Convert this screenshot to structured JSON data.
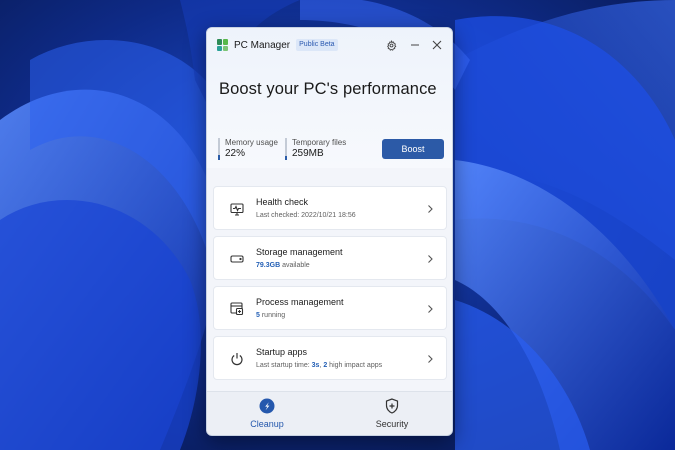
{
  "window": {
    "app_name": "PC Manager",
    "badge": "Public Beta",
    "hero_title": "Boost your PC's performance"
  },
  "metrics": {
    "memory": {
      "label": "Memory usage",
      "value": "22%",
      "level": 0.22
    },
    "temp": {
      "label": "Temporary files",
      "value": "259MB",
      "level": 0.2
    }
  },
  "boost_label": "Boost",
  "cards": [
    {
      "title": "Health check",
      "sub": "Last checked: 2022/10/21 18:56",
      "icon": "monitor-pulse-icon"
    },
    {
      "title": "Storage management",
      "sub_strong": "79.3GB",
      "sub_rest": " available",
      "icon": "drive-icon"
    },
    {
      "title": "Process management",
      "sub_strong": "5",
      "sub_rest": " running",
      "icon": "process-window-icon"
    },
    {
      "title": "Startup apps",
      "sub_prefix": "Last startup time: ",
      "sub_strong1": "3s",
      "sub_mid": ", ",
      "sub_strong2": "2",
      "sub_suffix": " high impact apps",
      "icon": "power-icon"
    }
  ],
  "nav": {
    "cleanup": {
      "label": "Cleanup",
      "icon": "rocket-icon"
    },
    "security": {
      "label": "Security",
      "icon": "shield-plus-icon"
    }
  },
  "colors": {
    "accent": "#2c5aa7",
    "logo": [
      "#2e8b57",
      "#57b84a",
      "#2aa198",
      "#7cc576"
    ]
  }
}
